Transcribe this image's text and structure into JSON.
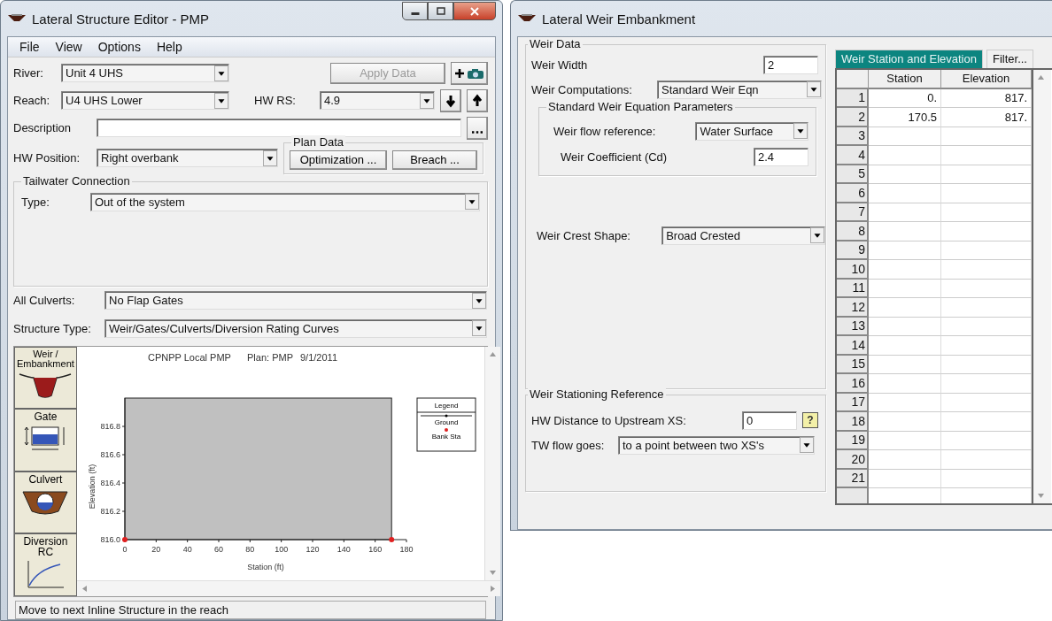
{
  "structure_editor": {
    "window": {
      "title": "Lateral Structure Editor - PMP"
    },
    "menu": [
      "File",
      "View",
      "Options",
      "Help"
    ],
    "river": {
      "label": "River:",
      "value": "Unit 4 UHS"
    },
    "apply_button": {
      "label": "Apply Data",
      "disabled": true
    },
    "reach": {
      "label": "Reach:",
      "value": "U4 UHS Lower"
    },
    "hw_rs": {
      "label": "HW RS:",
      "value": "4.9"
    },
    "description": {
      "label": "Description"
    },
    "hw_position": {
      "label": "HW Position:",
      "value": "Right overbank"
    },
    "plan_data": {
      "title": "Plan Data",
      "buttons": [
        "Optimization ...",
        "Breach ..."
      ]
    },
    "tailwater": {
      "title": "Tailwater Connection",
      "type_label": "Type:",
      "type_value": "Out of the system"
    },
    "all_culverts": {
      "label": "All Culverts:",
      "value": "No Flap Gates"
    },
    "structure_type": {
      "label": "Structure Type:",
      "value": "Weir/Gates/Culverts/Diversion Rating Curves"
    },
    "structure_buttons": [
      {
        "label": "Weir / Embankment",
        "kind": "weir"
      },
      {
        "label": "Gate",
        "kind": "gate"
      },
      {
        "label": "Culvert",
        "kind": "culvert"
      },
      {
        "label": "Diversion RC",
        "kind": "diversion"
      }
    ],
    "plot": {
      "title_parts": [
        "CPNPP Local PMP",
        "Plan: PMP",
        "9/1/2011"
      ],
      "legend": {
        "title": "Legend",
        "entries": [
          {
            "label": "Ground",
            "kind": "line"
          }
        ]
      },
      "chart_data": {
        "type": "scatter",
        "xlabel": "Station (ft)",
        "ylabel": "Elevation (ft)",
        "xlim": [
          0,
          180
        ],
        "ylim": [
          816,
          817
        ],
        "xticks": [
          0,
          20,
          40,
          60,
          80,
          100,
          120,
          140,
          160,
          180
        ],
        "yticks": [
          {
            "value": 816,
            "label": "816.0"
          },
          {
            "value": 816.2,
            "label": "816.2"
          },
          {
            "value": 816.4,
            "label": "816.4"
          },
          {
            "value": 816.6,
            "label": "816.6"
          },
          {
            "value": 816.8,
            "label": "816.8"
          }
        ],
        "x": [
          0,
          170.5
        ],
        "series": [
          {
            "name": "Bank Sta",
            "color": "#e02020",
            "values": [
              816,
              816
            ]
          }
        ]
      }
    },
    "status_bar": "Move to next Inline Structure in the reach"
  },
  "weir_window": {
    "window": {
      "title": "Lateral Weir Embankment"
    },
    "weir_data": {
      "title": "Weir Data",
      "width_label": "Weir Width",
      "width_value": "2",
      "computations_label": "Weir Computations:",
      "computations_value": "Standard Weir Eqn"
    },
    "standard_params": {
      "title": "Standard Weir Equation Parameters",
      "flow_ref_label": "Weir flow reference:",
      "flow_ref_value": "Water Surface",
      "coef_label": "Weir Coefficient (Cd)",
      "coef_value": "2.4"
    },
    "crest": {
      "label": "Weir Crest Shape:",
      "value": "Broad Crested"
    },
    "stationing": {
      "title": "Weir Stationing Reference",
      "hw_label": "HW Distance to Upstream XS:",
      "hw_value": "0",
      "help_label": "?",
      "tw_label": "TW flow goes:",
      "tw_value": "to a point between two XS's"
    },
    "table": {
      "tabs": [
        {
          "label": "Weir Station and Elevation",
          "selected": true
        },
        {
          "label": "Filter...",
          "selected": false
        }
      ],
      "columns": [
        "Station",
        "Elevation"
      ],
      "rows": [
        {
          "number": "1",
          "station": "0.",
          "elevation": "817."
        },
        {
          "number": "2",
          "station": "170.5",
          "elevation": "817."
        },
        {
          "number": "3"
        },
        {
          "number": "4"
        },
        {
          "number": "5"
        },
        {
          "number": "6"
        },
        {
          "number": "7"
        },
        {
          "number": "8"
        },
        {
          "number": "9"
        },
        {
          "number": "10"
        },
        {
          "number": "11"
        },
        {
          "number": "12"
        },
        {
          "number": "13"
        },
        {
          "number": "14"
        },
        {
          "number": "15"
        },
        {
          "number": "16"
        },
        {
          "number": "17"
        },
        {
          "number": "18"
        },
        {
          "number": "19"
        },
        {
          "number": "20"
        },
        {
          "number": "21"
        }
      ]
    }
  }
}
